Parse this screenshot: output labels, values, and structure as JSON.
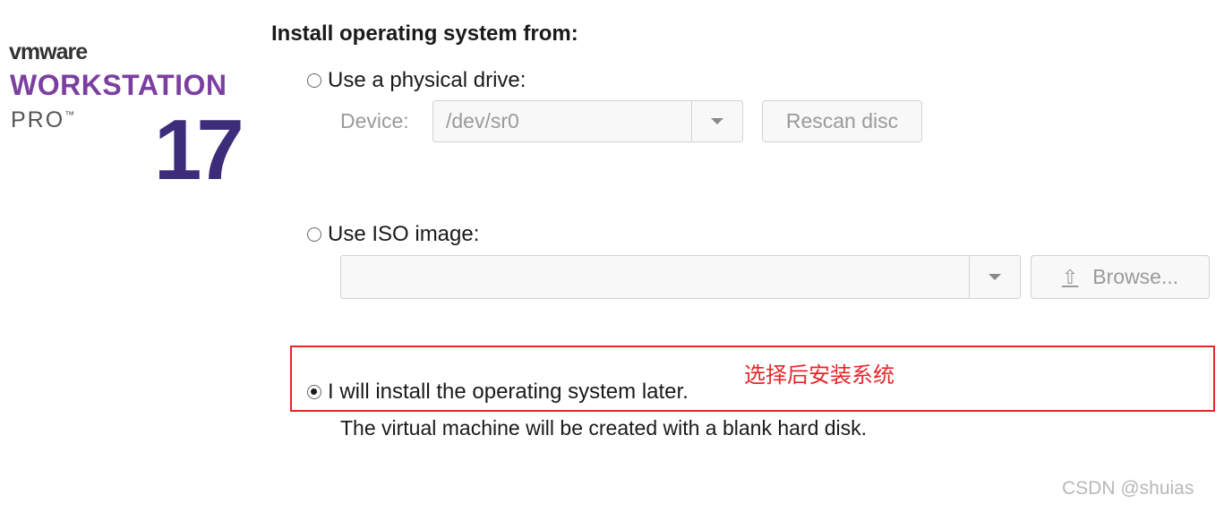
{
  "logo": {
    "brand": "vmware",
    "product": "WORKSTATION",
    "edition": "PRO",
    "trademark": "™",
    "version": "17"
  },
  "heading": "Install operating system from:",
  "options": {
    "physical_drive": {
      "label": "Use a physical drive:",
      "selected": false,
      "device_label": "Device:",
      "device_value": "/dev/sr0",
      "rescan_label": "Rescan disc"
    },
    "iso_image": {
      "label": "Use ISO image:",
      "selected": false,
      "path_value": "",
      "browse_label": "Browse..."
    },
    "install_later": {
      "label": "I will install the operating system later.",
      "selected": true,
      "description": "The virtual machine will be created with a blank hard disk."
    }
  },
  "annotation": {
    "text": "选择后安装系统",
    "color": "#e8262b"
  },
  "watermark": "CSDN @shuias",
  "colors": {
    "brand_purple": "#7b3fa0",
    "version_indigo": "#3c2c7a",
    "disabled_text": "#9a9a9a"
  }
}
